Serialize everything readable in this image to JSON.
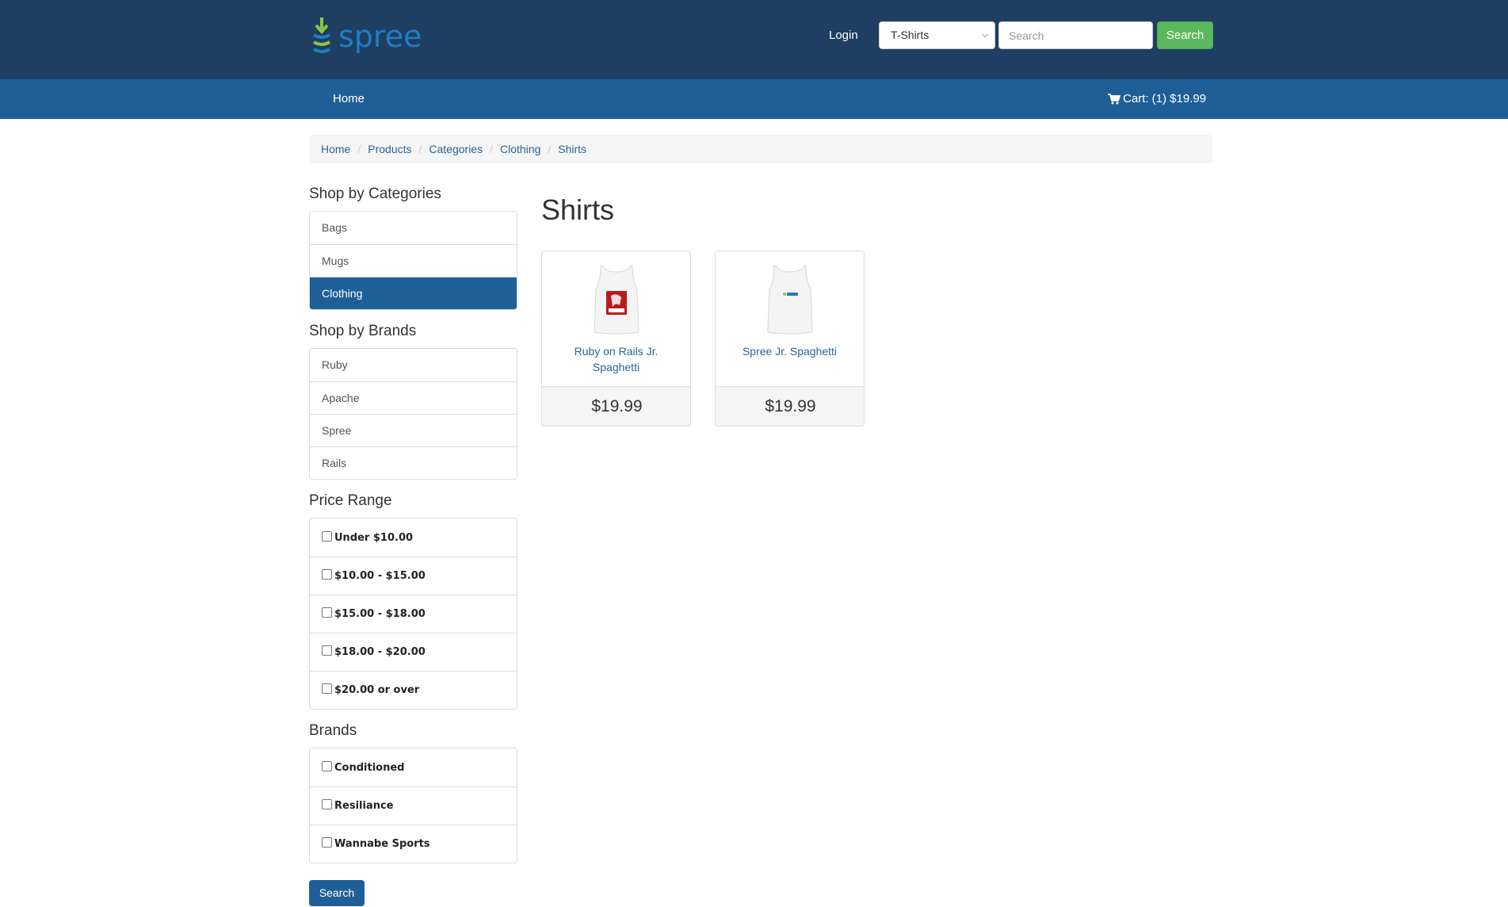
{
  "header": {
    "logo_text": "spree",
    "login_label": "Login",
    "taxon_select": "T-Shirts",
    "search_placeholder": "Search",
    "search_button": "Search"
  },
  "nav": {
    "home_label": "Home",
    "cart_label": "Cart: (1) $19.99"
  },
  "breadcrumbs": [
    "Home",
    "Products",
    "Categories",
    "Clothing",
    "Shirts"
  ],
  "sidebar": {
    "categories_title": "Shop by Categories",
    "categories": [
      "Bags",
      "Mugs",
      "Clothing"
    ],
    "active_category": "Clothing",
    "brands_title": "Shop by Brands",
    "brands": [
      "Ruby",
      "Apache",
      "Spree",
      "Rails"
    ],
    "price_title": "Price Range",
    "price_ranges": [
      "Under $10.00",
      "$10.00 - $15.00",
      "$15.00 - $18.00",
      "$18.00 - $20.00",
      "$20.00 or over"
    ],
    "brand_filter_title": "Brands",
    "brand_filters": [
      "Conditioned",
      "Resiliance",
      "Wannabe Sports"
    ],
    "search_button": "Search"
  },
  "main": {
    "title": "Shirts",
    "products": [
      {
        "name": "Ruby on Rails Jr. Spaghetti",
        "price": "$19.99",
        "image": "tank-top-rails-icon"
      },
      {
        "name": "Spree Jr. Spaghetti",
        "price": "$19.99",
        "image": "tank-top-spree-icon"
      }
    ]
  },
  "colors": {
    "header_bg": "#1e3e62",
    "nav_bg": "#1f5f97",
    "search_button": "#5cb85c",
    "link": "#2b6496"
  }
}
